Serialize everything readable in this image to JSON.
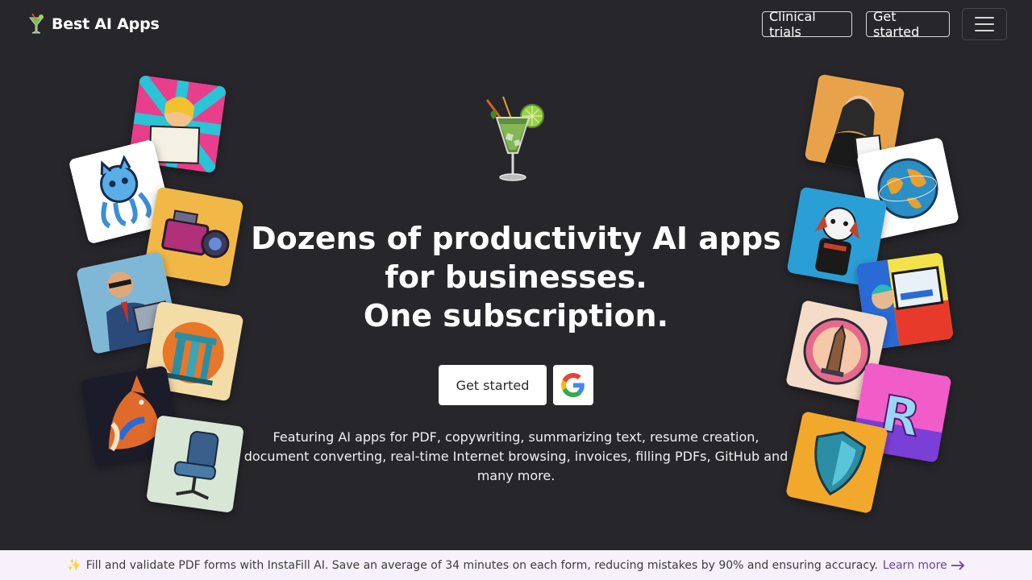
{
  "header": {
    "brand": "Best AI Apps",
    "clinical_trials": "Clinical trials",
    "get_started": "Get started"
  },
  "hero": {
    "headline_line1": "Dozens of productivity AI apps",
    "headline_line2": "for businesses.",
    "headline_line3": "One subscription.",
    "cta_label": "Get started",
    "description": "Featuring AI apps for PDF, copywriting, summarizing text, resume creation, document converting, real-time Internet browsing, invoices, filling PDFs, GitHub and many more."
  },
  "banner": {
    "icon": "sparkles-icon",
    "text": "Fill and validate PDF forms with InstaFill AI. Save an average of 34 minutes on each form, reducing mistakes by 90% and ensuring accuracy.",
    "link": "Learn more"
  },
  "tiles": [
    {
      "name": "woman-reading-tile-icon",
      "colors": [
        "#e83e8c",
        "#29c4d6"
      ]
    },
    {
      "name": "octopus-cat-tile-icon",
      "colors": [
        "#ffffff",
        "#3b8fd6"
      ]
    },
    {
      "name": "video-camera-tile-icon",
      "colors": [
        "#f2b847",
        "#b0307a"
      ]
    },
    {
      "name": "businessman-typewriter-tile-icon",
      "colors": [
        "#7fb8d6",
        "#2a4a7a"
      ]
    },
    {
      "name": "greek-columns-tile-icon",
      "colors": [
        "#f4dca6",
        "#e8772a"
      ]
    },
    {
      "name": "fox-tile-icon",
      "colors": [
        "#1b1b2a",
        "#e06a2a"
      ]
    },
    {
      "name": "office-chair-tile-icon",
      "colors": [
        "#d8e6d6",
        "#3a5f8a"
      ]
    },
    {
      "name": "businesswoman-tile-icon",
      "colors": [
        "#e8a34a",
        "#2a2a2a"
      ]
    },
    {
      "name": "globe-tile-icon",
      "colors": [
        "#ffffff",
        "#2a8fc4"
      ]
    },
    {
      "name": "dog-tile-icon",
      "colors": [
        "#2a9fd6",
        "#c8402a"
      ]
    },
    {
      "name": "find-me-computer-tile-icon",
      "colors": [
        "#f4e24a",
        "#2a6ad6"
      ]
    },
    {
      "name": "tower-badge-tile-icon",
      "colors": [
        "#f4dcc8",
        "#c8402a"
      ]
    },
    {
      "name": "letter-r-tile-icon",
      "colors": [
        "#f25cc8",
        "#7a3fd6"
      ]
    },
    {
      "name": "shield-tile-icon",
      "colors": [
        "#f2a82a",
        "#2a8fa4"
      ]
    }
  ]
}
